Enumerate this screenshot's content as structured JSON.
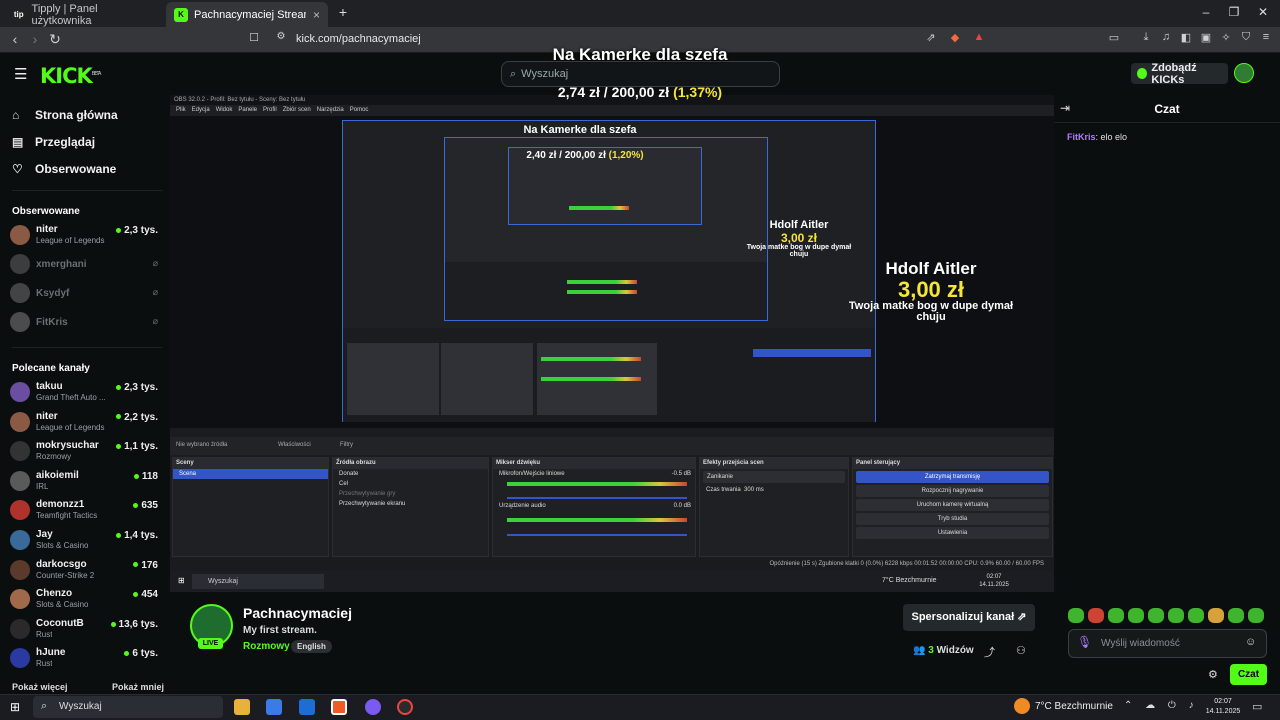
{
  "browser": {
    "tabs": [
      {
        "label": "Tipply | Panel użytkownika",
        "favicon": "tip"
      },
      {
        "label": "Pachnacymaciej Stream - Wa...",
        "favicon": "K"
      }
    ],
    "url": "kick.com/pachnacymaciej"
  },
  "kick_header": {
    "logo": "KICK",
    "logo_beta": "BETA",
    "search_placeholder": "Wyszukaj",
    "get_kicks_label": "Zdobądź KICKs"
  },
  "stream_overlay": {
    "goal_title": "Na Kamerke dla szefa",
    "goal_current": "2,74 zł",
    "goal_sep": "/",
    "goal_target": "200,00 zł",
    "goal_percent": "(1,37%)",
    "nested_goal_title": "Na Kamerke dla szefa",
    "nested_goal_amounts": "2,40 zł / 200,00 zł",
    "nested_goal_percent": "(1,20%)",
    "donation_name": "Hdolf Aitler",
    "donation_amount": "3,00 zł",
    "donation_message": "Twoja matke bog w dupe dymał chuju"
  },
  "obs": {
    "title": "OBS 32.0.2 - Profil: Bez tytułu - Sceny: Bez tytułu",
    "menu": [
      "Plik",
      "Edycja",
      "Widok",
      "Panele",
      "Profil",
      "Zbiór scen",
      "Narzędzia",
      "Pomoc"
    ],
    "source_bar": {
      "label": "Nie wybrano źródła",
      "properties": "Właściwości",
      "filters": "Filtry"
    },
    "scenes": {
      "header": "Sceny",
      "items": [
        "Scena"
      ]
    },
    "sources": {
      "header": "Źródła obrazu",
      "items": [
        "Donate",
        "Cel",
        "Przechwytywanie gry",
        "Przechwytywanie ekranu"
      ]
    },
    "mixer": {
      "header": "Mikser dźwięku",
      "ch1": "Mikrofon/Wejście liniowe",
      "ch1_db": "-0.5 dB",
      "ch2": "Urządzenie audio",
      "ch2_db": "0.0 dB"
    },
    "transitions": {
      "header": "Efekty przejścia scen",
      "type": "Zanikanie",
      "duration_label": "Czas trwania",
      "duration_value": "300 ms"
    },
    "controls": {
      "header": "Panel sterujący",
      "buttons": [
        "Zatrzymaj transmisję",
        "Rozpocznij nagrywanie",
        "Uruchom kamerę wirtualną",
        "Tryb studia",
        "Ustawienia"
      ]
    },
    "status": "Opóźnienie (15 s)   Zgubione klatki 0 (0.0%)   6228 kbps   00:01:52   00:00:00   CPU: 0.9%   60.00 / 60.00 FPS",
    "inner_search": "Wyszukaj",
    "inner_weather": "7°C  Bezchmurnie",
    "inner_clock": "02:07 14.11.2025"
  },
  "sidebar": {
    "nav": [
      {
        "label": "Strona główna",
        "icon": "home-icon"
      },
      {
        "label": "Przeglądaj",
        "icon": "browse-icon"
      },
      {
        "label": "Obserwowane",
        "icon": "heart-icon"
      }
    ],
    "followed_title": "Obserwowane",
    "followed": [
      {
        "name": "niter",
        "category": "League of Legends",
        "viewers": "2,3 tys.",
        "live": true,
        "color": "#8a5a44"
      },
      {
        "name": "xmerghani",
        "category": "",
        "viewers": "",
        "live": false,
        "color": "#777777"
      },
      {
        "name": "Ksydyf",
        "category": "",
        "viewers": "",
        "live": false,
        "color": "#888888"
      },
      {
        "name": "FitKris",
        "category": "",
        "viewers": "",
        "live": false,
        "color": "#999999"
      }
    ],
    "recommended_title": "Polecane kanały",
    "recommended": [
      {
        "name": "takuu",
        "category": "Grand Theft Auto ...",
        "viewers": "2,3 tys.",
        "color": "#6a4fa0"
      },
      {
        "name": "niter",
        "category": "League of Legends",
        "viewers": "2,2 tys.",
        "color": "#8a5a44"
      },
      {
        "name": "mokrysuchar",
        "category": "Rozmowy",
        "viewers": "1,1 tys.",
        "color": "#333333"
      },
      {
        "name": "aikoiemil",
        "category": "IRL",
        "viewers": "118",
        "color": "#5a5a5a"
      },
      {
        "name": "demonzz1",
        "category": "Teamfight Tactics",
        "viewers": "635",
        "color": "#b0322d"
      },
      {
        "name": "Jay",
        "category": "Slots & Casino",
        "viewers": "1,4 tys.",
        "color": "#3a6a9a"
      },
      {
        "name": "darkocsgo",
        "category": "Counter-Strike 2",
        "viewers": "176",
        "color": "#5a3a2a"
      },
      {
        "name": "Chenzo",
        "category": "Slots & Casino",
        "viewers": "454",
        "color": "#a06a4a"
      },
      {
        "name": "CoconutB",
        "category": "Rust",
        "viewers": "13,6 tys.",
        "color": "#2a2a2a"
      },
      {
        "name": "hJune",
        "category": "Rust",
        "viewers": "6 tys.",
        "color": "#2a3aa0"
      }
    ],
    "show_more": "Pokaż więcej",
    "show_less": "Pokaż mniej"
  },
  "channel": {
    "name": "Pachnacymaciej",
    "title": "My first stream.",
    "category": "Rozmowy",
    "language": "English",
    "live_badge": "LIVE",
    "customize_label": "Spersonalizuj kanał",
    "viewers_count": "3",
    "viewers_label": "Widzów"
  },
  "chat": {
    "title": "Czat",
    "messages": [
      {
        "user": "FitKris",
        "text": "elo elo"
      }
    ],
    "input_placeholder": "Wyślij wiadomość",
    "send_label": "Czat"
  },
  "taskbar": {
    "search_placeholder": "Wyszukaj",
    "weather": "7°C  Bezchmurnie",
    "time": "02:07",
    "date": "14.11.2025"
  },
  "colors": {
    "accent": "#53fc18",
    "background": "#0b0e0f",
    "obs_blue": "#3455c8",
    "goal_yellow": "#f5e43a"
  }
}
